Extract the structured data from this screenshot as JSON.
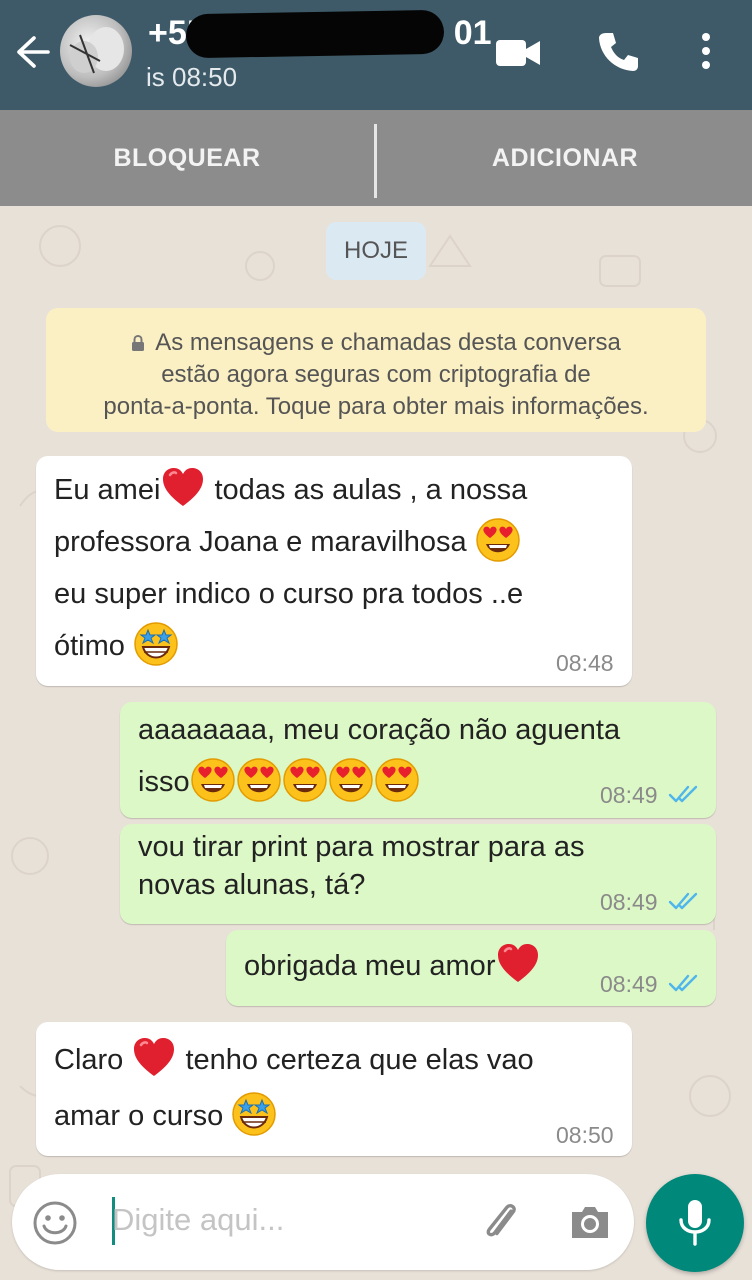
{
  "header": {
    "contact_name": "+55",
    "contact_name_tail": "01",
    "status": "is 08:50",
    "icons": [
      "back-arrow-icon",
      "video-call-icon",
      "phone-icon",
      "more-options-icon"
    ]
  },
  "actions": {
    "block_label": "BLOQUEAR",
    "add_label": "ADICIONAR"
  },
  "chat": {
    "day_label": "HOJE",
    "encryption_notice": [
      "As mensagens e chamadas desta conversa",
      "estão agora seguras com criptografia de",
      "ponta-a-ponta. Toque para obter mais informações."
    ],
    "messages": [
      {
        "direction": "incoming",
        "lines": [
          "Eu amei",
          "todas as aulas , a nossa",
          "professora Joana e maravilhosa",
          "eu super indico o curso pra todos ..e",
          "ótimo"
        ],
        "time": "08:48"
      },
      {
        "direction": "outgoing",
        "lines": [
          "aaaaaaaa, meu coração não aguenta",
          "isso"
        ],
        "time": "08:49"
      },
      {
        "direction": "outgoing",
        "lines": [
          "vou tirar print para mostrar para as",
          "novas alunas, tá?"
        ],
        "time": "08:49"
      },
      {
        "direction": "outgoing",
        "lines": [
          "obrigada meu amor"
        ],
        "time": "08:49"
      },
      {
        "direction": "incoming",
        "lines": [
          "Claro",
          "tenho certeza que elas vao",
          "amar  o curso"
        ],
        "time": "08:50"
      }
    ]
  },
  "composer": {
    "placeholder": "Digite aqui...",
    "icons": [
      "emoji-icon",
      "attach-icon",
      "camera-icon",
      "mic-icon"
    ]
  },
  "colors": {
    "header": "#3e5a68",
    "action_bar": "#8c8c8c",
    "incoming_bubble": "#ffffff",
    "outgoing_bubble": "#dcf8c6",
    "notice_bg": "#fbf0c4",
    "day_pill_bg": "#dbe9f3",
    "read_ticks": "#4fb6ec",
    "mic_button": "#00897b"
  }
}
